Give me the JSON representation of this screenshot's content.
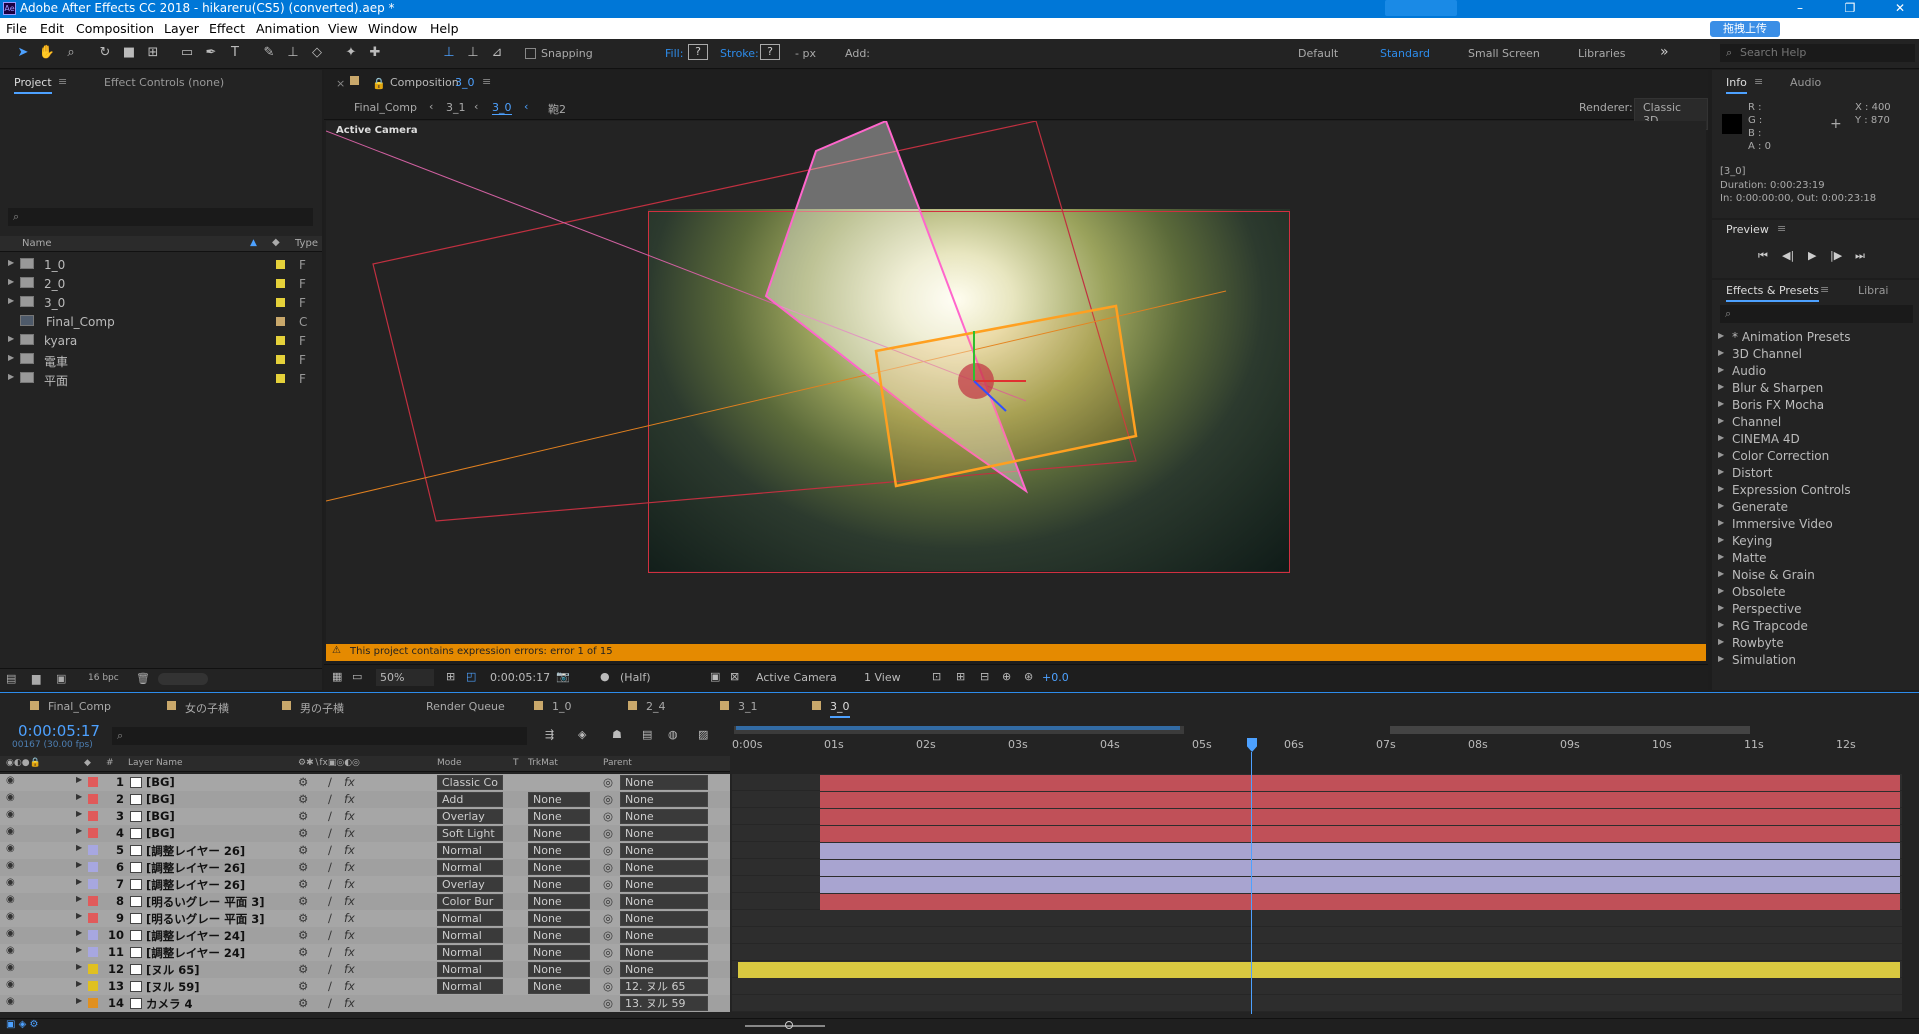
{
  "window": {
    "title": "Adobe After Effects CC 2018 - hikareru(CS5) (converted).aep *",
    "min": "–",
    "max": "❐",
    "close": "✕",
    "ime": "拖拽上传"
  },
  "menu": [
    "File",
    "Edit",
    "Composition",
    "Layer",
    "Effect",
    "Animation",
    "View",
    "Window",
    "Help"
  ],
  "toolbar": {
    "snapping": "Snapping",
    "fill": "Fill:",
    "stroke": "Stroke:",
    "q": "?",
    "px": "- px",
    "add": "Add:",
    "workspaces": [
      "Default",
      "Standard",
      "Small Screen",
      "Libraries"
    ],
    "more": "»",
    "search_placeholder": "Search Help"
  },
  "project": {
    "tab_project": "Project",
    "tab_effect": "Effect Controls (none)",
    "col_name": "Name",
    "col_type": "Type",
    "items": [
      {
        "name": "1_0",
        "type": "F",
        "folder": true
      },
      {
        "name": "2_0",
        "type": "F",
        "folder": true
      },
      {
        "name": "3_0",
        "type": "F",
        "folder": true
      },
      {
        "name": "Final_Comp",
        "type": "C",
        "folder": false
      },
      {
        "name": "kyara",
        "type": "F",
        "folder": true
      },
      {
        "name": "電車",
        "type": "F",
        "folder": true
      },
      {
        "name": "平面",
        "type": "F",
        "folder": true
      }
    ],
    "bpc": "16 bpc"
  },
  "comp": {
    "tab": "Composition",
    "tab_name": "3_0",
    "crumbs": [
      "Final_Comp",
      "3_1",
      "3_0",
      "鞄2"
    ],
    "renderer_label": "Renderer:",
    "renderer": "Classic 3D",
    "active_camera": "Active Camera",
    "error": "This project contains expression errors: error 1 of 15",
    "zoom": "50%",
    "time": "0:00:05:17",
    "resolution": "(Half)",
    "view": "Active Camera",
    "views": "1 View",
    "exposure": "+0.0"
  },
  "info": {
    "tab_info": "Info",
    "tab_audio": "Audio",
    "r": "R :",
    "g": "G :",
    "b": "B :",
    "a": "A : 0",
    "x": "X : 400",
    "y": "Y : 870",
    "comp_name": "[3_0]",
    "duration": "Duration: 0:00:23:19",
    "inout": "In: 0:00:00:00, Out: 0:00:23:18",
    "preview": "Preview"
  },
  "effects": {
    "tab": "Effects & Presets",
    "tab2": "Librai",
    "items": [
      "* Animation Presets",
      "3D Channel",
      "Audio",
      "Blur & Sharpen",
      "Boris FX Mocha",
      "Channel",
      "CINEMA 4D",
      "Color Correction",
      "Distort",
      "Expression Controls",
      "Generate",
      "Immersive Video",
      "Keying",
      "Matte",
      "Noise & Grain",
      "Obsolete",
      "Perspective",
      "RG Trapcode",
      "Rowbyte",
      "Simulation"
    ]
  },
  "timeline": {
    "tabs": [
      "Final_Comp",
      "女の子横",
      "男の子横",
      "Render Queue",
      "1_0",
      "2_4",
      "3_1",
      "3_0"
    ],
    "timecode": "0:00:05:17",
    "frames": "00167 (30.00 fps)",
    "cols": {
      "num": "#",
      "name": "Layer Name",
      "mode": "Mode",
      "t": "T",
      "trkmat": "TrkMat",
      "parent": "Parent"
    },
    "ruler": [
      "0:00s",
      "01s",
      "02s",
      "03s",
      "04s",
      "05s",
      "06s",
      "07s",
      "08s",
      "09s",
      "10s",
      "11s",
      "12s"
    ],
    "layers": [
      {
        "n": "1",
        "name": "[BG]",
        "color": "#e05a5a",
        "mode": "Classic Co",
        "trk": "",
        "parent": "None"
      },
      {
        "n": "2",
        "name": "[BG]",
        "color": "#e05a5a",
        "mode": "Add",
        "trk": "None",
        "parent": "None"
      },
      {
        "n": "3",
        "name": "[BG]",
        "color": "#e05a5a",
        "mode": "Overlay",
        "trk": "None",
        "parent": "None"
      },
      {
        "n": "4",
        "name": "[BG]",
        "color": "#e05a5a",
        "mode": "Soft Light",
        "trk": "None",
        "parent": "None"
      },
      {
        "n": "5",
        "name": "[調整レイヤー 26]",
        "color": "#a7a7e0",
        "mode": "Normal",
        "trk": "None",
        "parent": "None"
      },
      {
        "n": "6",
        "name": "[調整レイヤー 26]",
        "color": "#a7a7e0",
        "mode": "Normal",
        "trk": "None",
        "parent": "None"
      },
      {
        "n": "7",
        "name": "[調整レイヤー 26]",
        "color": "#a7a7e0",
        "mode": "Overlay",
        "trk": "None",
        "parent": "None"
      },
      {
        "n": "8",
        "name": "[明るいグレー 平面 3]",
        "color": "#e05a5a",
        "mode": "Color Bur",
        "trk": "None",
        "parent": "None"
      },
      {
        "n": "9",
        "name": "[明るいグレー 平面 3]",
        "color": "#e05a5a",
        "mode": "Normal",
        "trk": "None",
        "parent": "None"
      },
      {
        "n": "10",
        "name": "[調整レイヤー 24]",
        "color": "#a7a7e0",
        "mode": "Normal",
        "trk": "None",
        "parent": "None"
      },
      {
        "n": "11",
        "name": "[調整レイヤー 24]",
        "color": "#a7a7e0",
        "mode": "Normal",
        "trk": "None",
        "parent": "None"
      },
      {
        "n": "12",
        "name": "[ヌル 65]",
        "color": "#e0c020",
        "mode": "Normal",
        "trk": "None",
        "parent": "None"
      },
      {
        "n": "13",
        "name": "[ヌル 59]",
        "color": "#e0c020",
        "mode": "Normal",
        "trk": "None",
        "parent": "12. ヌル 65"
      },
      {
        "n": "14",
        "name": "カメラ 4",
        "color": "#e09020",
        "mode": "",
        "trk": "",
        "parent": "13. ヌル 59"
      }
    ]
  }
}
